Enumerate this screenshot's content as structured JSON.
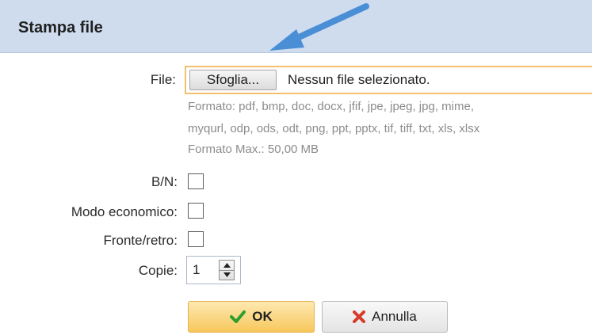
{
  "dialog": {
    "title": "Stampa file"
  },
  "form": {
    "file_label": "File:",
    "browse_label": "Sfoglia...",
    "no_file_text": "Nessun file selezionato.",
    "hint_line1": "Formato: pdf, bmp, doc, docx, jfif, jpe, jpeg, jpg, mime,",
    "hint_line2": "myqurl, odp, ods, odt, png, ppt, pptx, tif, tiff, txt, xls, xlsx",
    "hint_line3": "Formato Max.: 50,00 MB",
    "bw_label": "B/N:",
    "eco_label": "Modo economico:",
    "duplex_label": "Fronte/retro:",
    "copies_label": "Copie:",
    "copies_value": "1",
    "bw_checked": false,
    "eco_checked": false,
    "duplex_checked": false
  },
  "buttons": {
    "ok_label": "OK",
    "cancel_label": "Annulla"
  },
  "colors": {
    "titlebar_bg": "#cfdcee",
    "annotation_arrow": "#4a8fd6",
    "ok_check": "#2e9e2e",
    "cancel_x": "#d63b2b"
  },
  "icons": {
    "ok": "check-icon",
    "cancel": "x-icon",
    "spin_up": "triangle-up-icon",
    "spin_down": "triangle-down-icon",
    "annotation": "arrow-icon"
  }
}
